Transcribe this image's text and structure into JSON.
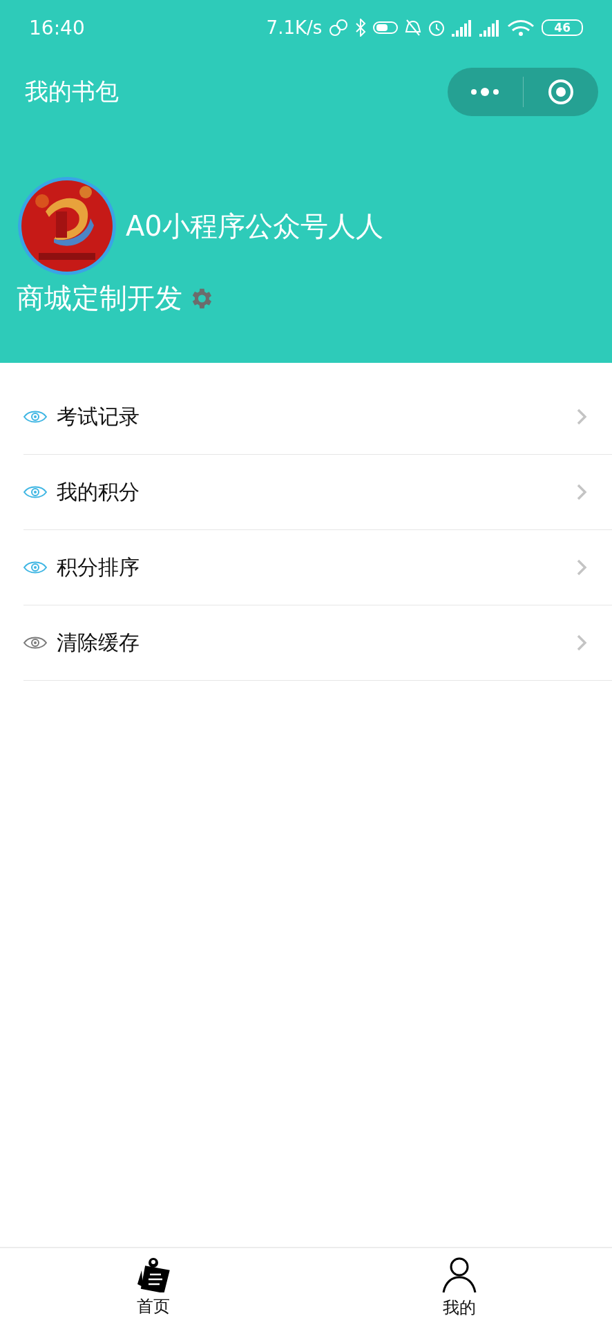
{
  "status_bar": {
    "time": "16:40",
    "speed": "7.1K/s",
    "battery": "46"
  },
  "nav": {
    "title": "我的书包"
  },
  "profile": {
    "name": "A0小程序公众号人人",
    "subtitle": "商城定制开发"
  },
  "menu": [
    {
      "label": "考试记录",
      "color": "#3fb6e3"
    },
    {
      "label": "我的积分",
      "color": "#3fb6e3"
    },
    {
      "label": "积分排序",
      "color": "#3fb6e3"
    },
    {
      "label": "清除缓存",
      "color": "#7a7a7a"
    }
  ],
  "tab_bar": [
    {
      "label": "首页",
      "kind": "notes"
    },
    {
      "label": "我的",
      "kind": "person"
    }
  ]
}
